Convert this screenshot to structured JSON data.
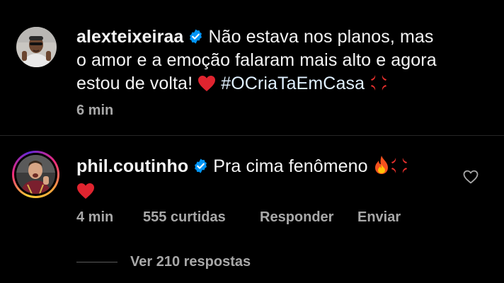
{
  "comments": [
    {
      "username": "alexteixeiraa",
      "verified": true,
      "text_line1": "Não estava nos planos, mas",
      "text_line2": "o amor e a emoção falaram mais alto e agora",
      "text_line3": "estou de volta!",
      "hashtag": "#OCriaTaEmCasa",
      "time": "6 min"
    },
    {
      "username": "phil.coutinho",
      "verified": true,
      "text": "Pra cima fenômeno",
      "time": "4 min",
      "likes": "555 curtidas",
      "reply_label": "Responder",
      "send_label": "Enviar",
      "view_replies": "Ver 210 respostas"
    }
  ],
  "colors": {
    "background": "#000000",
    "text": "#f5f5f5",
    "muted": "#a8a8a8",
    "verified": "#0095f6",
    "hashtag": "#e0f1ff",
    "divider": "#262626"
  },
  "icons": {
    "verified": "verified-badge-icon",
    "heart_emoji": "red-heart-emoji",
    "anger_emoji": "anger-symbol-emoji",
    "fire_emoji": "fire-emoji",
    "like": "heart-outline-icon"
  }
}
